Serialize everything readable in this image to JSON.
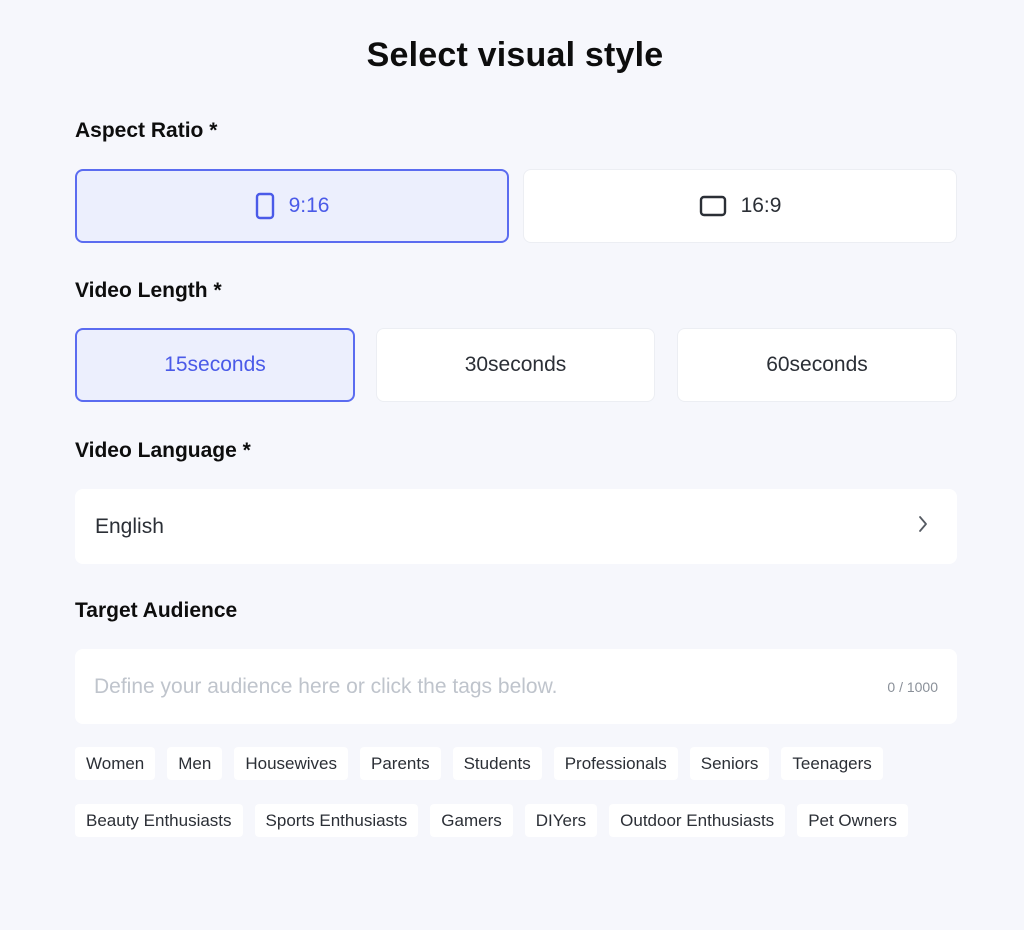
{
  "title": "Select visual style",
  "aspect_ratio": {
    "label": "Aspect Ratio *",
    "options": [
      {
        "label": "9:16",
        "icon": "portrait-rect-icon",
        "selected": true
      },
      {
        "label": "16:9",
        "icon": "landscape-rect-icon",
        "selected": false
      }
    ]
  },
  "video_length": {
    "label": "Video Length *",
    "options": [
      {
        "label": "15seconds",
        "selected": true
      },
      {
        "label": "30seconds",
        "selected": false
      },
      {
        "label": "60seconds",
        "selected": false
      }
    ]
  },
  "video_language": {
    "label": "Video Language *",
    "value": "English",
    "icon": "chevron-right-icon"
  },
  "target_audience": {
    "label": "Target Audience",
    "placeholder": "Define your audience here or click the tags below.",
    "counter": "0 / 1000",
    "tags_row1": [
      "Women",
      "Men",
      "Housewives",
      "Parents",
      "Students",
      "Professionals",
      "Seniors",
      "Teenagers"
    ],
    "tags_row2": [
      "Beauty Enthusiasts",
      "Sports Enthusiasts",
      "Gamers",
      "DIYers",
      "Outdoor Enthusiasts",
      "Pet Owners"
    ]
  },
  "colors": {
    "accent": "#5b6cf0",
    "selected_bg": "#eceffd",
    "page_bg": "#f6f7fc"
  }
}
